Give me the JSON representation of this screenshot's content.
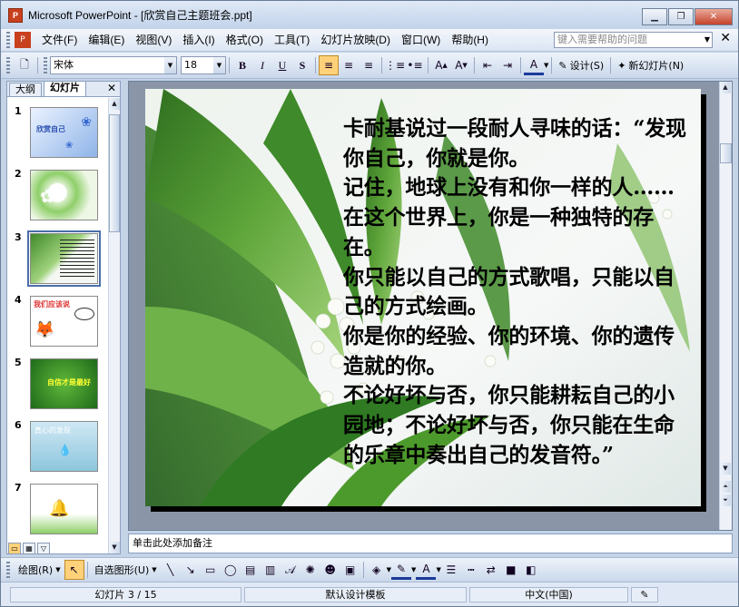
{
  "window": {
    "title": "Microsoft PowerPoint - [欣赏自己主题班会.ppt]",
    "app_icon": "P"
  },
  "menu": {
    "items": [
      "文件(F)",
      "编辑(E)",
      "视图(V)",
      "插入(I)",
      "格式(O)",
      "工具(T)",
      "幻灯片放映(D)",
      "窗口(W)",
      "帮助(H)"
    ],
    "help_placeholder": "键入需要帮助的问题"
  },
  "toolbar": {
    "font_name": "宋体",
    "font_size": "18",
    "design_label": "设计(S)",
    "new_slide_label": "新幻灯片(N)"
  },
  "left_pane": {
    "tabs": [
      "大纲",
      "幻灯片"
    ],
    "active_tab": "幻灯片",
    "slides": [
      {
        "num": "1",
        "thumb_text": "欣赏自己"
      },
      {
        "num": "2",
        "thumb_text": ""
      },
      {
        "num": "3",
        "thumb_text": ""
      },
      {
        "num": "4",
        "thumb_text": "我们应该说"
      },
      {
        "num": "5",
        "thumb_text": "自信才是最好"
      },
      {
        "num": "6",
        "thumb_text": "真心的发现"
      },
      {
        "num": "7",
        "thumb_text": ""
      }
    ],
    "selected_slide": "3"
  },
  "slide": {
    "paragraphs": [
      "卡耐基说过一段耐人寻味的话：“发现你自己，你就是你。",
      "记住，地球上没有和你一样的人……在这个世界上，你是一种独特的存在。",
      "你只能以自己的方式歌唱，只能以自己的方式绘画。",
      "你是你的经验、你的环境、你的遗传造就的你。",
      "不论好坏与否，你只能耕耘自己的小园地；不论好坏与否，你只能在生命的乐章中奏出自己的发音符。”"
    ]
  },
  "notes": {
    "placeholder": "单击此处添加备注"
  },
  "drawing": {
    "draw_label": "绘图(R)",
    "autoshapes_label": "自选图形(U)"
  },
  "status": {
    "slide_info": "幻灯片 3 / 15",
    "template": "默认设计模板",
    "language": "中文(中国)"
  },
  "colors": {
    "accent": "#ffd27a",
    "chrome": "#c4d3e6"
  }
}
